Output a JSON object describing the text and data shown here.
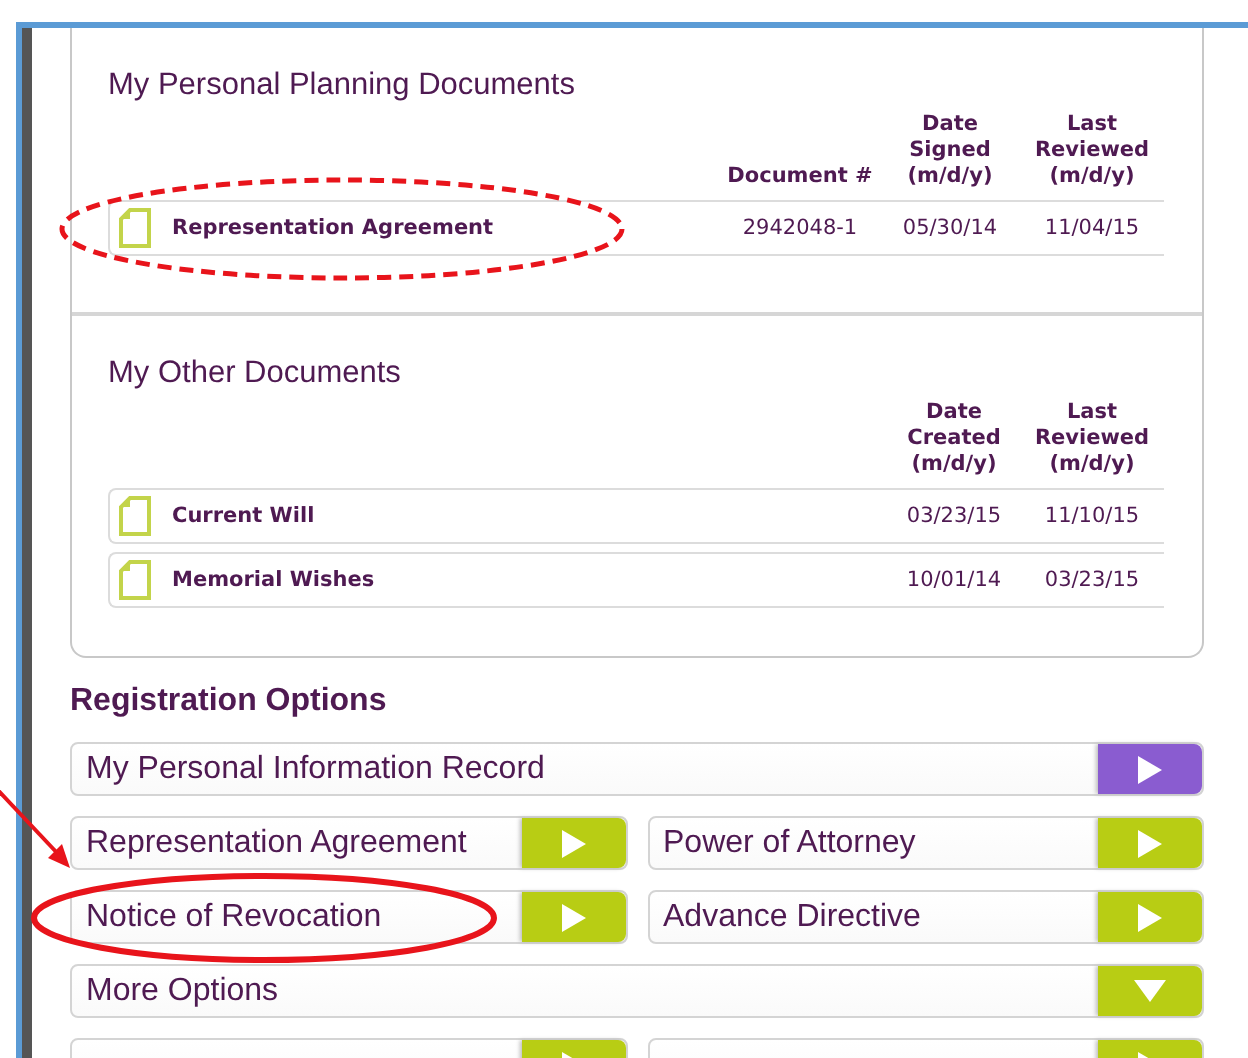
{
  "documents": [
    {
      "title": "My Personal Planning Documents",
      "columns": [
        "Document #",
        "Date Signed (m/d/y)",
        "Last Reviewed (m/d/y)"
      ],
      "rows": [
        {
          "name": "Representation Agreement",
          "cells": [
            "2942048-1",
            "05/30/14",
            "11/04/15"
          ],
          "circled": true
        }
      ]
    },
    {
      "title": "My Other Documents",
      "columns": [
        "Date Created (m/d/y)",
        "Last Reviewed (m/d/y)"
      ],
      "rows": [
        {
          "name": "Current Will",
          "cells": [
            "03/23/15",
            "11/10/15"
          ],
          "circled": false
        },
        {
          "name": "Memorial Wishes",
          "cells": [
            "10/01/14",
            "03/23/15"
          ],
          "circled": false
        }
      ]
    }
  ],
  "registration": {
    "title": "Registration Options",
    "rows": [
      [
        {
          "label": "My Personal Information Record",
          "color": "#8a5cd0",
          "kind": "open",
          "circled": false,
          "arrow": false
        }
      ],
      [
        {
          "label": "Representation Agreement",
          "color": "#b8cd14",
          "kind": "open",
          "circled": false,
          "arrow": false
        },
        {
          "label": "Power of Attorney",
          "color": "#b8cd14",
          "kind": "open",
          "circled": false,
          "arrow": false
        }
      ],
      [
        {
          "label": "Notice of Revocation",
          "color": "#b8cd14",
          "kind": "open",
          "circled": true,
          "arrow": true
        },
        {
          "label": "Advance Directive",
          "color": "#b8cd14",
          "kind": "open",
          "circled": false,
          "arrow": false
        }
      ],
      [
        {
          "label": "More Options",
          "color": "#b8cd14",
          "kind": "expand",
          "circled": false,
          "arrow": false
        }
      ],
      [
        {
          "color": "#b8cd14",
          "kind": "open",
          "circled": false,
          "arrow": false
        },
        {
          "color": "#b8cd14",
          "kind": "open",
          "circled": false,
          "arrow": false
        }
      ]
    ]
  }
}
